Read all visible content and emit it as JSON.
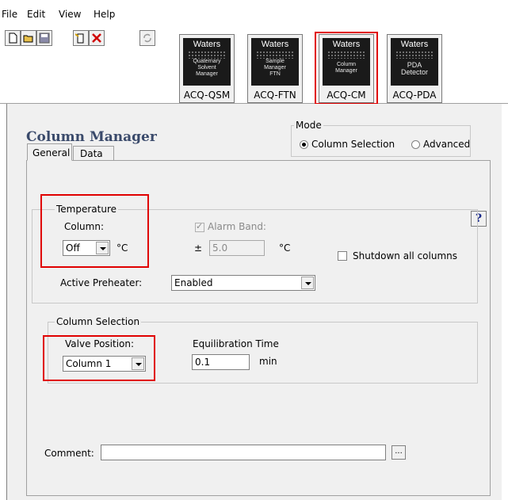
{
  "menu": {
    "file": "File",
    "edit": "Edit",
    "view": "View",
    "help": "Help"
  },
  "toolbar": {
    "icons": [
      "new-document-icon",
      "open-folder-icon",
      "save-icon",
      "properties-icon",
      "delete-icon",
      "refresh-icon"
    ]
  },
  "instruments": [
    {
      "brand": "Waters",
      "caption": [
        "Quaternary",
        "Solvent",
        "Manager"
      ],
      "label": "ACQ-QSM"
    },
    {
      "brand": "Waters",
      "caption": [
        "Sample",
        "Manager",
        "FTN"
      ],
      "label": "ACQ-FTN"
    },
    {
      "brand": "Waters",
      "caption": [
        "Column",
        "Manager"
      ],
      "label": "ACQ-CM",
      "selected": true
    },
    {
      "brand": "Waters",
      "caption": [
        "PDA",
        "Detector"
      ],
      "label": "ACQ-PDA"
    }
  ],
  "panel": {
    "title": "Column Manager",
    "mode": {
      "caption": "Mode",
      "options": [
        {
          "label": "Column Selection",
          "selected": true
        },
        {
          "label": "Advanced",
          "selected": false
        }
      ]
    },
    "tabs": [
      {
        "label": "General",
        "active": true
      },
      {
        "label": "Data",
        "active": false
      }
    ],
    "help_label": "?",
    "temperature": {
      "caption": "Temperature",
      "column_label": "Column:",
      "column_value": "Off",
      "unit": "°C",
      "alarm_band_label": "Alarm Band:",
      "alarm_checked": true,
      "plusminus": "±",
      "alarm_value": "5.0",
      "alarm_unit": "°C",
      "shutdown_label": "Shutdown all columns",
      "shutdown_checked": false,
      "preheater_label": "Active Preheater:",
      "preheater_value": "Enabled"
    },
    "column_selection": {
      "caption": "Column Selection",
      "valve_label": "Valve Position:",
      "valve_value": "Column 1",
      "equil_label": "Equilibration Time",
      "equil_value": "0.1",
      "equil_unit": "min"
    },
    "comment": {
      "label": "Comment:",
      "value": "",
      "browse_label": "..."
    }
  },
  "colors": {
    "highlight": "#e00000",
    "title": "#3a4a6b",
    "panel_bg": "#f0f0f0"
  }
}
